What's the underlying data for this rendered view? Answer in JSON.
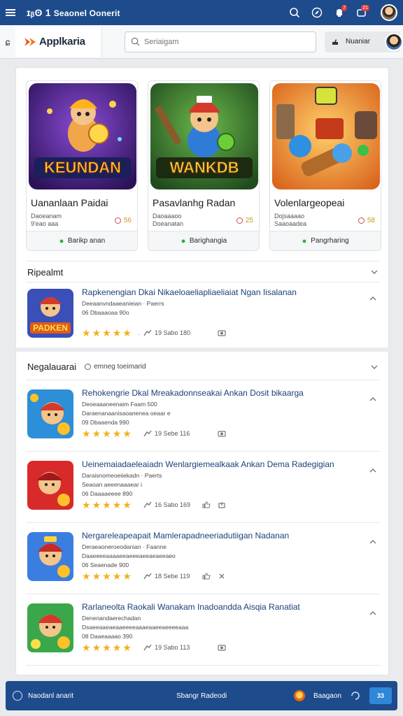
{
  "system_bar": {
    "brand_bold": "ɪᵦʘ 1",
    "brand_text": "Seaonel Oonerit",
    "notif_badge": "7",
    "msg_badge": "21"
  },
  "app_header": {
    "back_glyph": "ɕ",
    "logo_text": "Applkaria",
    "search_placeholder": "Seriaigam",
    "user_label": "Nuaniar"
  },
  "featured": [
    {
      "title": "Uananlaan Paidai",
      "sub1": "Daoeanam",
      "sub2": "9'eao aaa",
      "score": "56",
      "button": "Barikp anan",
      "art_word": "KEUNDAN"
    },
    {
      "title": "Pasavlanhg Radan",
      "sub1": "Daoaaaoo",
      "sub2": "Doeanatan",
      "score": "25",
      "button": "Barighangia",
      "art_word": "WANKDB"
    },
    {
      "title": "Volenlargeopeai",
      "sub1": "Dojsaaaao",
      "sub2": "Saaoaadea",
      "score": "58",
      "button": "Pangrharing",
      "art_word": ""
    }
  ],
  "section1": {
    "title": "Ripealmt",
    "items": [
      {
        "title": "Rapkenengian Dkai Nikaeloaeliapliaeliaiat Ngan Iisalanan",
        "meta1": "Deeaanvndaaeanieian · Paerrs",
        "meta2": "06 Dbaaaoaa 90o",
        "meta3": "",
        "stat": "19 Sabo 180",
        "art": "PADKEN"
      }
    ]
  },
  "section2": {
    "title": "Negalauarai",
    "pill": "emneg toeimarid",
    "items": [
      {
        "title": "Rehokengrie Dkal Mreakadonnseakai Ankan Dosit bikaarga",
        "meta1": "Deoeaaaneenaim Faam 500",
        "meta2": "Daraenanaanisaoanenea oeaar e",
        "meta3": "09 Dbaaenda 990",
        "stat": "19 Sebe 116"
      },
      {
        "title": "Ueinemaiadaeleaiadn Wenlargiemealkaak Ankan Dema Radegigian",
        "meta1": "Daraisnomeoeiiekadn · Paerts",
        "meta2": "Seaoan aeeenaaaear i",
        "meta3": "06 Daaaaeeee 890",
        "stat": "16 Sabo 169"
      },
      {
        "title": "Nergareleapeapait Mamlerapadneeriadutiigan Nadanan",
        "meta1": "Deraeaoneroeodanian · Faanne",
        "meta2": "Daaeeeeaaaaeeaeeeaeeaeaeeaeo",
        "meta3": "06 Seaenade 900",
        "stat": "18 Sebe 119"
      },
      {
        "title": "Rarlaneolta Raokali Wanakam Inadoandda Aisqia Ranatiat",
        "meta1": "Denenandaerechadan",
        "meta2": "Dsaeeaaeaeaaeeeeaaaeaaeeaeeeeaaa",
        "meta3": "08 Daaeaaaao 390",
        "stat": "19 Sabo 113"
      }
    ]
  },
  "bottom_bar": {
    "left": "Naodanl anarit",
    "mid": "Sbangr Radeodi",
    "right": "Baagaon",
    "cta": "33"
  },
  "colors": {
    "primary": "#1e4b8c",
    "link": "#1c3f7a",
    "star": "#f0b21a",
    "ok": "#3aa84a"
  }
}
